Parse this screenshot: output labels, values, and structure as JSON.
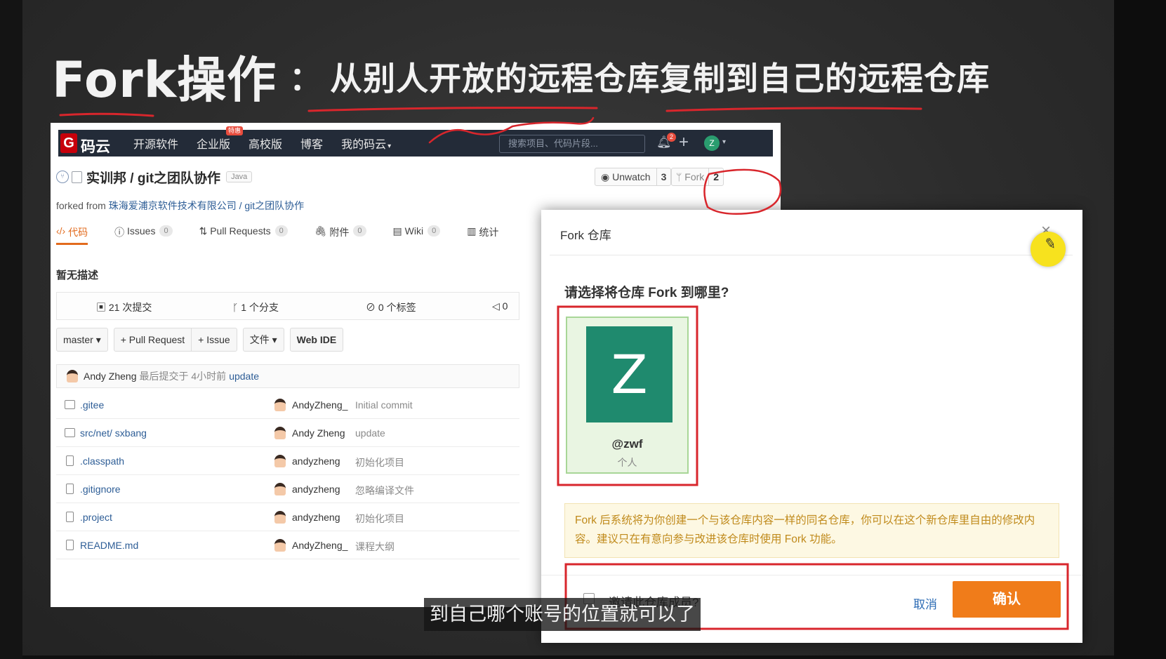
{
  "slide": {
    "title_main": "Fork操作",
    "title_sep": "：",
    "title_sub": "从别人开放的远程仓库复制到自己的远程仓库"
  },
  "topnav": {
    "logo_mark": "G",
    "logo_text": "码云",
    "links": [
      "开源软件",
      "企业版",
      "高校版",
      "博客",
      "我的码云"
    ],
    "hot_badge": "特惠",
    "search_placeholder": "搜索项目、代码片段...",
    "bell_badge": "2",
    "avatar_letter": "Z"
  },
  "repo": {
    "path": "实训邦 / git之团队协作",
    "language": "Java",
    "watch_label": "Unwatch",
    "watch_count": "3",
    "fork_label": "Fork",
    "fork_count": "2",
    "forked_prefix": "forked from",
    "forked_source": "珠海爱浦京软件技术有限公司 / git之团队协作",
    "description": "暂无描述"
  },
  "tabs": [
    {
      "label": "代码",
      "icon": "code-icon",
      "count": ""
    },
    {
      "label": "Issues",
      "icon": "issue-icon",
      "count": "0"
    },
    {
      "label": "Pull Requests",
      "icon": "pull-request-icon",
      "count": "0"
    },
    {
      "label": "附件",
      "icon": "attachment-icon",
      "count": "0"
    },
    {
      "label": "Wiki",
      "icon": "wiki-icon",
      "count": "0"
    },
    {
      "label": "统计",
      "icon": "stats-icon",
      "count": ""
    }
  ],
  "stats": {
    "commits": "21 次提交",
    "branches": "1 个分支",
    "tags": "0 个标签",
    "releases": "0"
  },
  "toolbar": {
    "branch": "master",
    "pull_request": "+ Pull Request",
    "issue": "+ Issue",
    "files": "文件",
    "web_ide": "Web IDE"
  },
  "last_commit": {
    "author": "Andy Zheng",
    "meta": "最后提交于 4小时前",
    "message": "update"
  },
  "files": [
    {
      "name": ".gitee",
      "type": "folder",
      "author": "AndyZheng_",
      "message": "Initial commit"
    },
    {
      "name": "src/net/ sxbang",
      "type": "folder",
      "author": "Andy Zheng",
      "message": "update"
    },
    {
      "name": ".classpath",
      "type": "file",
      "author": "andyzheng",
      "message": "初始化项目"
    },
    {
      "name": ".gitignore",
      "type": "file",
      "author": "andyzheng",
      "message": "忽略编译文件"
    },
    {
      "name": ".project",
      "type": "file",
      "author": "andyzheng",
      "message": "初始化项目"
    },
    {
      "name": "README.md",
      "type": "file",
      "author": "AndyZheng_",
      "message": "课程大纲"
    }
  ],
  "dialog": {
    "title": "Fork 仓库",
    "close": "×",
    "question": "请选择将仓库 Fork 到哪里?",
    "account_letter": "Z",
    "account_handle": "@zwf",
    "account_type": "个人",
    "notice": "Fork 后系统将为你创建一个与该仓库内容一样的同名仓库，你可以在这个新仓库里自由的修改内容。建议只在有意向参与改进该仓库时使用 Fork 功能。",
    "invite_label": "邀请此仓库成员?",
    "cancel": "取消",
    "confirm": "确认"
  },
  "subtitle": "到自己哪个账号的位置就可以了",
  "colors": {
    "nav_bg": "#232b38",
    "accent_orange": "#f07c1a",
    "avatar_green": "#1f8a6e",
    "annotation_red": "#d8262c",
    "cursor_yellow": "#f7e21e"
  }
}
